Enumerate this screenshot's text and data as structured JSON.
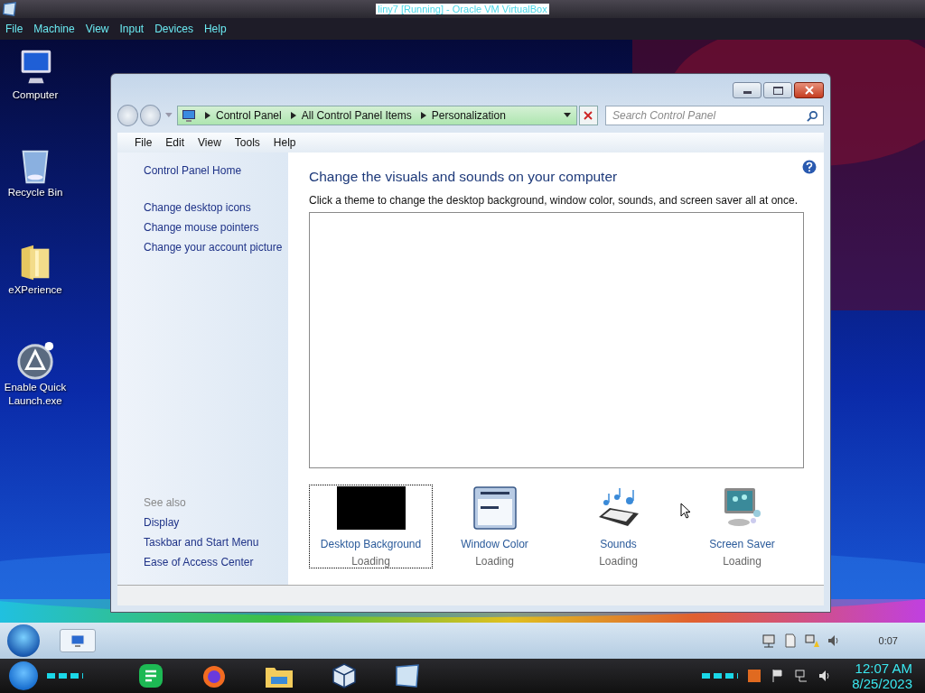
{
  "vbox": {
    "title": "liny7 [Running] - Oracle VM VirtualBox",
    "menu": [
      "File",
      "Machine",
      "View",
      "Input",
      "Devices",
      "Help"
    ]
  },
  "desktop_icons": [
    {
      "label": "Computer",
      "kind": "computer"
    },
    {
      "label": "Recycle Bin",
      "kind": "bin"
    },
    {
      "label": "eXPerience",
      "kind": "folder"
    },
    {
      "label": "Enable Quick Launch.exe",
      "kind": "app"
    }
  ],
  "window": {
    "address": [
      "Control Panel",
      "All Control Panel Items",
      "Personalization"
    ],
    "search": {
      "placeholder": "Search Control Panel"
    },
    "menu": [
      "File",
      "Edit",
      "View",
      "Tools",
      "Help"
    ],
    "sidebar": {
      "home": "Control Panel Home",
      "links": [
        "Change desktop icons",
        "Change mouse pointers",
        "Change your account picture"
      ],
      "see_also_heading": "See also",
      "see_also": [
        "Display",
        "Taskbar and Start Menu",
        "Ease of Access Center"
      ]
    },
    "heading": "Change the visuals and sounds on your computer",
    "description": "Click a theme to change the desktop background, window color, sounds, and screen saver all at once.",
    "tiles": [
      {
        "label": "Desktop Background",
        "status": "Loading",
        "kind": "background",
        "selected": true
      },
      {
        "label": "Window Color",
        "status": "Loading",
        "kind": "color",
        "selected": false
      },
      {
        "label": "Sounds",
        "status": "Loading",
        "kind": "sounds",
        "selected": false
      },
      {
        "label": "Screen Saver",
        "status": "Loading",
        "kind": "saver",
        "selected": false
      }
    ]
  },
  "guest_taskbar": {
    "clock": "0:07"
  },
  "host_taskbar": {
    "time": "12:07 AM",
    "date": "8/25/2023"
  }
}
